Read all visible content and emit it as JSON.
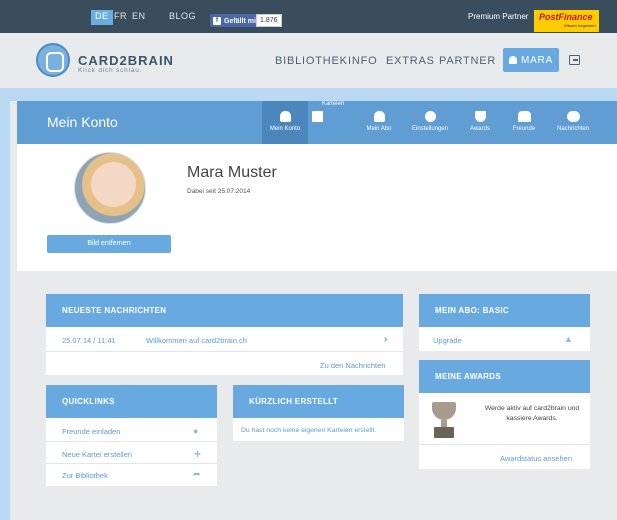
{
  "topbar": {
    "languages": [
      "DE",
      "FR",
      "EN"
    ],
    "active_language": "DE",
    "blog": "BLOG",
    "facebook_label": "Gefällt mir",
    "facebook_count": "1.876",
    "premium_partner": "Premium Partner",
    "partner_name": "PostFinance",
    "partner_slogan": "Wissen begeistert"
  },
  "header": {
    "brand": "CARD2BRAIN",
    "slogan": "Klick dich schlau.",
    "nav": [
      "BIBLIOTHEK",
      "INFO",
      "EXTRAS",
      "PARTNER"
    ],
    "user_button": "MARA"
  },
  "account": {
    "title": "Mein Konto",
    "tabs": [
      {
        "label": "Mein Konto",
        "icon": "person-icon"
      },
      {
        "label": "Karteien",
        "icon": "cards-icon"
      },
      {
        "label": "Mein Abo",
        "icon": "subscription-icon"
      },
      {
        "label": "Einstellungen",
        "icon": "gear-icon"
      },
      {
        "label": "Awards",
        "icon": "trophy-icon"
      },
      {
        "label": "Freunde",
        "icon": "friends-icon"
      },
      {
        "label": "Nachrichten",
        "icon": "chat-icon"
      }
    ]
  },
  "profile": {
    "name": "Mara Muster",
    "since": "Dabei seit 25.07.2014",
    "remove_button": "Bild entfernen"
  },
  "news": {
    "title": "NEUESTE NACHRICHTEN",
    "item_date": "25.07.14 / 11:41",
    "item_text": "Willkommen auf card2brain.ch",
    "link": "Zu den Nachrichten"
  },
  "quicklinks": {
    "title": "QUICKLINKS",
    "items": [
      "Freunde einladen",
      "Neue Kartei erstellen",
      "Zur Bibliothek"
    ]
  },
  "recent": {
    "title": "KÜRZLICH ERSTELLT",
    "empty_text": "Du hast noch keine eigenen Karteien erstellt."
  },
  "abo": {
    "title": "MEIN ABO: BASIC",
    "upgrade": "Upgrade"
  },
  "awards": {
    "title": "MEINE AWARDS",
    "text": "Werde aktiv auf card2brain und kassiere Awards.",
    "link": "Awardstatus ansehen"
  },
  "colors": {
    "topbar": "#3a4d5d",
    "accent": "#68aae0",
    "account_bar": "#5f9dd2",
    "link": "#5f9ad0"
  }
}
